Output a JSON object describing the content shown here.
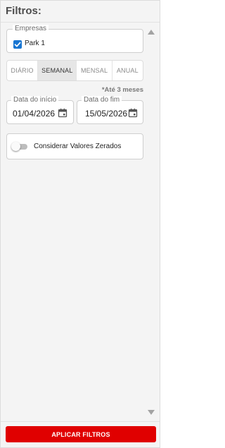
{
  "filters": {
    "title": "Filtros:"
  },
  "companies": {
    "legend": "Empresas",
    "items": [
      {
        "label": "Park 1",
        "checked": true
      }
    ]
  },
  "period": {
    "options": [
      "DIÁRIO",
      "SEMANAL",
      "MENSAL",
      "ANUAL"
    ],
    "selected": "SEMANAL",
    "range_note": "*Até 3 meses"
  },
  "dates": {
    "start_label": "Data do início",
    "start_value": "01/04/2026",
    "end_label": "Data do fim",
    "end_value": "15/05/2026"
  },
  "zero_values": {
    "label": "Considerar Valores Zerados",
    "enabled": false
  },
  "footer": {
    "apply_label": "APLICAR FILTROS"
  },
  "colors": {
    "accent": "#1976d2",
    "apply_button": "#e00000",
    "panel_background": "#f4f4f4"
  },
  "icons": {
    "checkbox": "check-icon",
    "date_picker": "calendar-icon",
    "scroll_up": "triangle-up-icon",
    "scroll_down": "triangle-down-icon"
  }
}
